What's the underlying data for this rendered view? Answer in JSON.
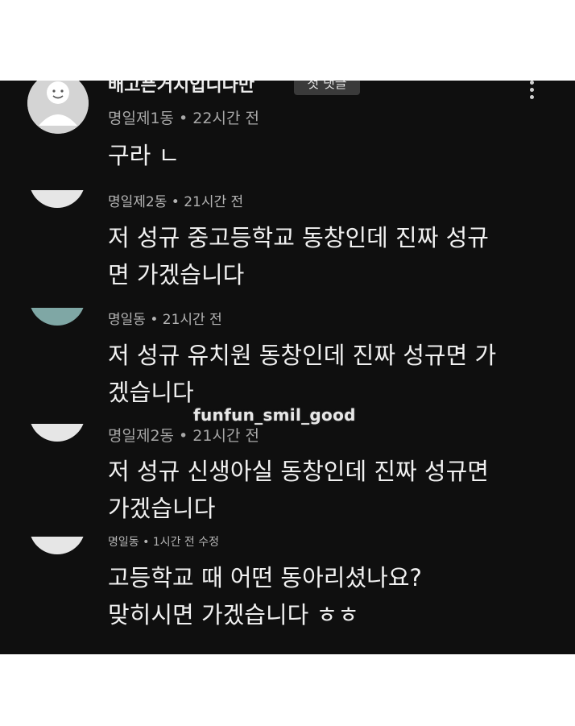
{
  "watermark": "funfun_smil_good",
  "comments": [
    {
      "author": "배고픈거지입니다만",
      "badge": "첫 댓글",
      "meta": "명일제1동 • 22시간 전",
      "lines": [
        "구라 ㄴ"
      ]
    },
    {
      "meta": "명일제2동 • 21시간 전",
      "lines": [
        "저 성규 중고등학교 동창인데 진짜 성규",
        "면 가겠습니다"
      ]
    },
    {
      "meta": "명일동 • 21시간 전",
      "lines": [
        "저 성규 유치원 동창인데 진짜 성규면 가",
        "겠습니다"
      ]
    },
    {
      "meta": "명일제2동 • 21시간 전",
      "lines": [
        "저 성규 신생아실 동창인데 진짜 성규면",
        "가겠습니다"
      ]
    },
    {
      "meta": "명일동 • 1시간 전 수정",
      "lines": [
        "고등학교 때 어떤 동아리셨나요?",
        "맞히시면 가겠습니다 ㅎㅎ"
      ]
    }
  ],
  "icons": {
    "more": "more-vertical-icon",
    "avatar": "default-avatar-icon"
  },
  "colors": {
    "background": "#0f0f0f",
    "text": "#f1f1f1",
    "meta": "#a8a8a8"
  }
}
